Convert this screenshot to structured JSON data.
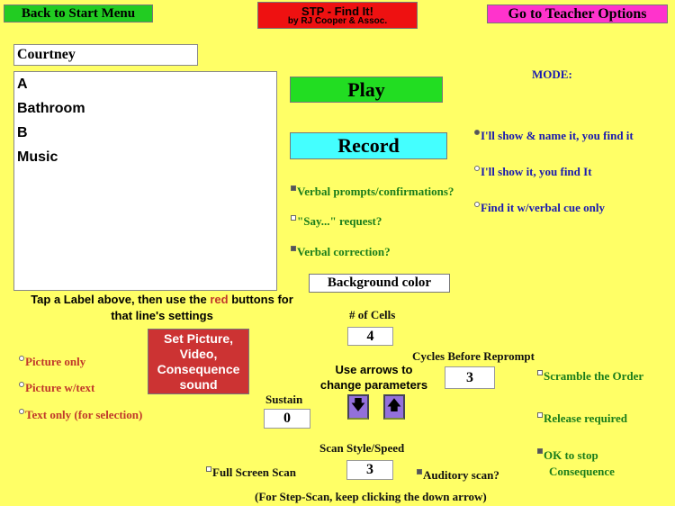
{
  "header": {
    "back_button": "Back to Start Menu",
    "title": "STP - Find It!",
    "subtitle": "by RJ Cooper & Assoc.",
    "teacher_button": "Go to Teacher Options"
  },
  "user_name": "Courtney",
  "labels": [
    "A",
    "Bathroom",
    "B",
    "Music"
  ],
  "instruction": {
    "part1": "Tap a Label above, then use the ",
    "red_word": "red",
    "part2": " buttons for",
    "line2": "that line's settings"
  },
  "play_button": "Play",
  "record_button": "Record",
  "mode": {
    "title": "MODE:",
    "options": [
      {
        "label": "I'll show & name it, you find it",
        "selected": true
      },
      {
        "label": "I'll show it, you find It",
        "selected": false
      },
      {
        "label": "Find it w/verbal cue only",
        "selected": false
      }
    ]
  },
  "verbal_options": [
    {
      "label": "Verbal prompts/confirmations?",
      "checked": true
    },
    {
      "label": "\"Say...\" request?",
      "checked": false
    },
    {
      "label": "Verbal correction?",
      "checked": true
    }
  ],
  "background_color_button": "Background color",
  "display_options": [
    {
      "label": "Picture only",
      "selected": false
    },
    {
      "label": "Picture w/text",
      "selected": false
    },
    {
      "label": "Text only (for selection)",
      "selected": false
    }
  ],
  "set_picture_button": "Set Picture, Video, Consequence sound",
  "cells": {
    "label": "# of Cells",
    "value": "4"
  },
  "arrows_hint": {
    "line1": "Use arrows to",
    "line2": "change parameters"
  },
  "cycles": {
    "label": "Cycles Before Reprompt",
    "value": "3"
  },
  "sustain": {
    "label": "Sustain",
    "value": "0"
  },
  "scan": {
    "label": "Scan Style/Speed",
    "value": "3"
  },
  "full_screen_scan": {
    "label": "Full Screen Scan",
    "checked": false
  },
  "auditory_scan": {
    "label": "Auditory scan?",
    "checked": true
  },
  "right_options": [
    {
      "label": "Scramble the Order",
      "checked": false
    },
    {
      "label": "Release required",
      "checked": false
    }
  ],
  "ok_to_stop": {
    "line1": "OK to stop",
    "line2": "Consequence",
    "checked": true
  },
  "footer_note": "(For Step-Scan, keep clicking the down arrow)",
  "colors": {
    "background": "#ffff66",
    "play": "#22dd22",
    "record": "#44ffff",
    "title": "#ee1111",
    "teacher": "#ff33cc",
    "set_picture": "#cc3333",
    "arrows": "#9370db"
  }
}
